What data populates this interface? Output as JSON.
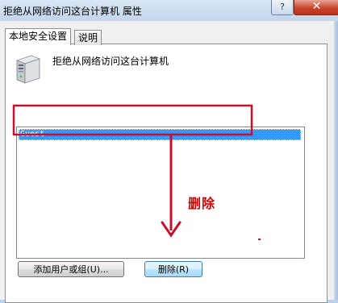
{
  "window": {
    "title": "拒绝从网络访问这台计算机 属性",
    "help_glyph": "?",
    "close_glyph": "✕"
  },
  "tabs": [
    {
      "label": "本地安全设置",
      "active": true
    },
    {
      "label": "说明",
      "active": false
    }
  ],
  "policy": {
    "icon": "computer-tower-icon",
    "label": "拒绝从网络访问这台计算机"
  },
  "list": {
    "items": [
      {
        "label": "Guest",
        "selected": true
      }
    ]
  },
  "buttons": {
    "add": "添加用户或组(U)...",
    "remove": "删除(R)"
  },
  "annotation": {
    "text": "删除",
    "color": "#d50000"
  }
}
